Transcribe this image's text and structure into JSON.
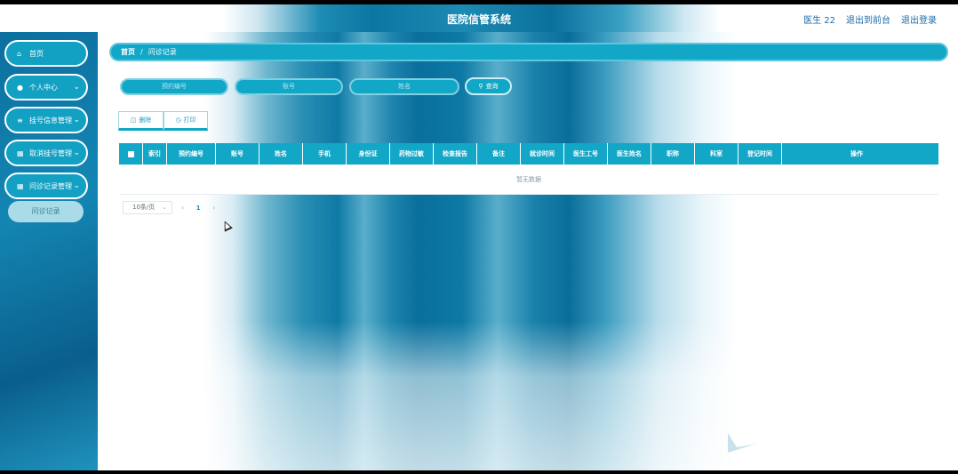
{
  "header": {
    "title": "医院信管系统",
    "user": "医生 22",
    "to_front": "退出到前台",
    "logout": "退出登录"
  },
  "sidebar": {
    "items": [
      {
        "label": "首页",
        "icon": "home-icon"
      },
      {
        "label": "个人中心",
        "icon": "user-icon"
      },
      {
        "label": "挂号信息管理",
        "icon": "sliders-icon"
      },
      {
        "label": "取消挂号管理",
        "icon": "grid-icon"
      },
      {
        "label": "问诊记录管理",
        "icon": "grid-icon"
      }
    ],
    "submenu": {
      "label": "问诊记录"
    }
  },
  "breadcrumb": {
    "home": "首页",
    "separator": "/",
    "current": "问诊记录"
  },
  "search": {
    "appointment_no_placeholder": "预约编号",
    "account_placeholder": "账号",
    "name_placeholder": "姓名",
    "query_label": "查询"
  },
  "actions": {
    "delete_label": "删除",
    "print_label": "打印"
  },
  "table": {
    "columns": [
      "索引",
      "预约编号",
      "账号",
      "姓名",
      "手机",
      "身份证",
      "药物过敏",
      "检查报告",
      "备注",
      "就诊时间",
      "医生工号",
      "医生姓名",
      "职称",
      "科室",
      "登记时间",
      "操作"
    ],
    "empty_text": "暂无数据"
  },
  "pagination": {
    "page_size": "10条/页",
    "current_page": "1"
  },
  "colors": {
    "accent": "#12a7c7",
    "sidebar": "#0c6f9e"
  }
}
